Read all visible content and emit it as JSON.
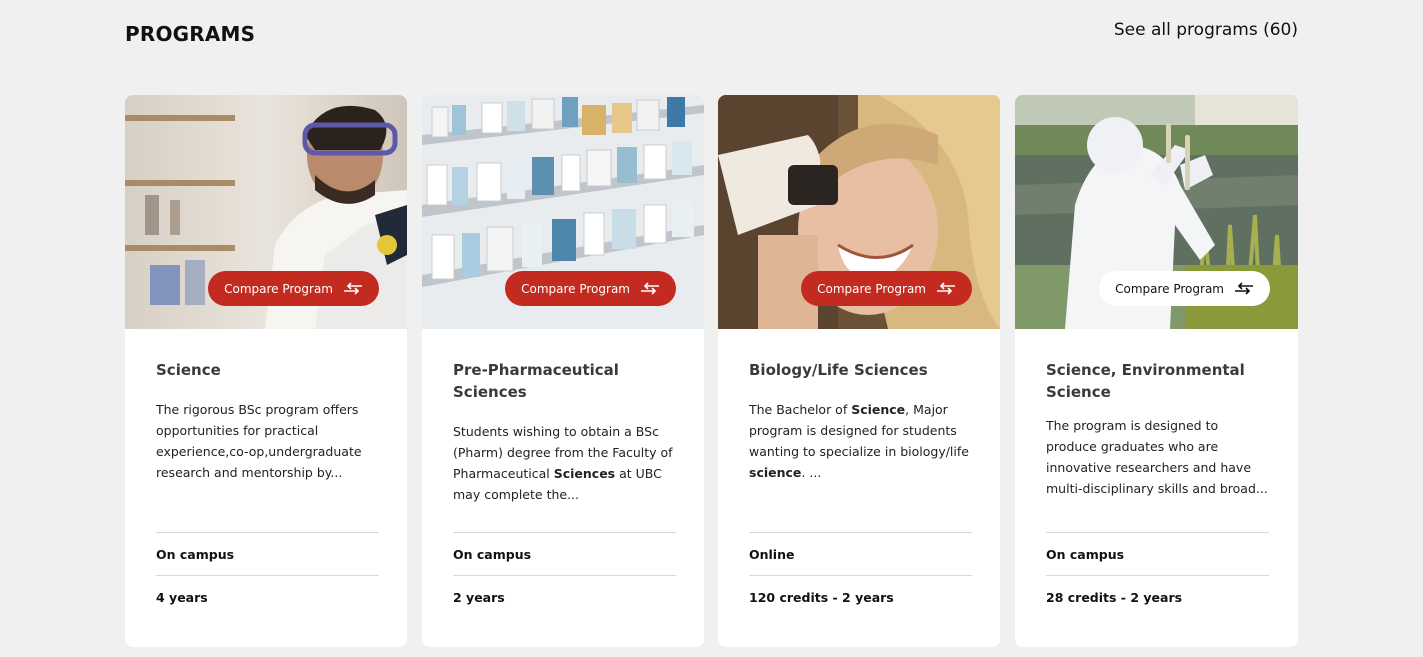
{
  "header": {
    "title": "PROGRAMS",
    "see_all": "See all programs (60)"
  },
  "colors": {
    "accent": "#c42b20",
    "background": "#f0f0f0",
    "card": "#ffffff"
  },
  "cards": [
    {
      "title": "Science",
      "compare_label": "Compare Program",
      "compare_style": "red",
      "desc": "The rigorous BSc program offers opportunities for practical experience,co-op,undergraduate research and mentorship by...",
      "mode": "On campus",
      "duration": "4 years",
      "image": "lab-student-goggles"
    },
    {
      "title": "Pre-Pharmaceutical Sciences",
      "compare_label": "Compare Program",
      "compare_style": "red",
      "desc_parts": [
        "Students wishing to obtain a BSc (Pharm) degree from the Faculty of Pharmaceutical ",
        "Sciences",
        " at UBC may complete the..."
      ],
      "mode": "On campus",
      "duration": "2 years",
      "image": "pharmacy-shelves"
    },
    {
      "title": "Biology/Life Sciences",
      "compare_label": "Compare Program",
      "compare_style": "red",
      "desc_parts": [
        "The Bachelor of ",
        "Science",
        ", Major program is designed for students wanting to specialize in biology/life ",
        "science",
        ". ..."
      ],
      "mode": "Online",
      "duration": "120 credits - 2 years",
      "image": "student-microscope"
    },
    {
      "title": "Science, Environmental Science",
      "compare_label": "Compare Program",
      "compare_style": "white",
      "desc": "The program is designed to produce graduates who are innovative researchers and have multi-disciplinary skills and broad...",
      "mode": "On campus",
      "duration": "28 credits - 2 years",
      "image": "field-sampling-pond"
    }
  ]
}
